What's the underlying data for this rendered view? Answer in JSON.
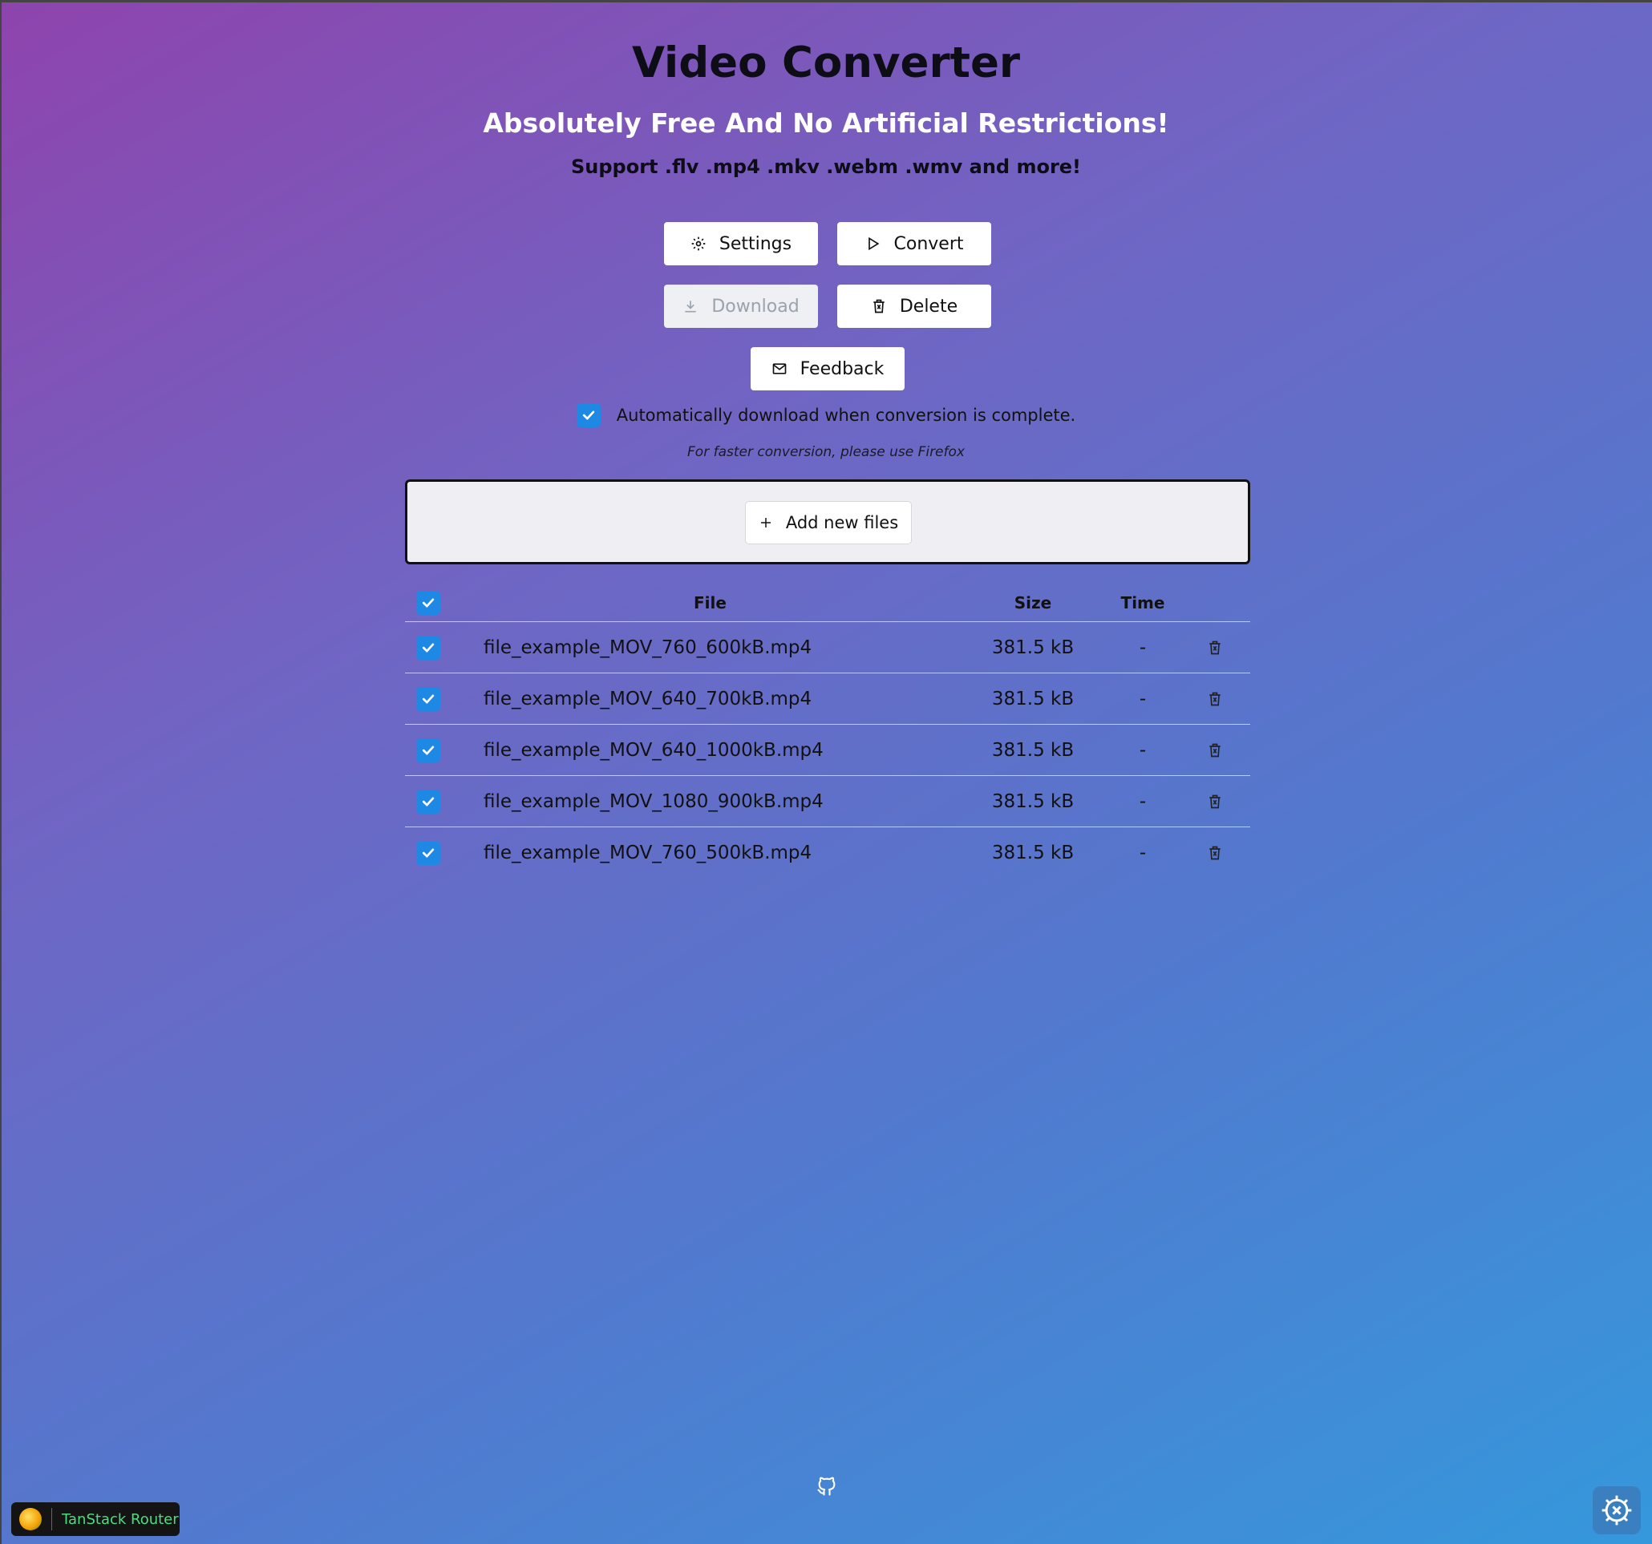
{
  "header": {
    "title": "Video Converter",
    "subtitle": "Absolutely Free And No Artificial Restrictions!",
    "support": "Support .flv .mp4 .mkv .webm .wmv and more!"
  },
  "toolbar": {
    "settings_label": "Settings",
    "convert_label": "Convert",
    "download_label": "Download",
    "delete_label": "Delete",
    "feedback_label": "Feedback"
  },
  "auto_download": {
    "label": "Automatically download when conversion is complete.",
    "checked": true
  },
  "hint": "For faster conversion, please use Firefox",
  "dropzone": {
    "add_label": "Add new files"
  },
  "table": {
    "headers": {
      "file": "File",
      "size": "Size",
      "time": "Time"
    },
    "rows": [
      {
        "file": "file_example_MOV_760_600kB.mp4",
        "size": "381.5 kB",
        "time": "-"
      },
      {
        "file": "file_example_MOV_640_700kB.mp4",
        "size": "381.5 kB",
        "time": "-"
      },
      {
        "file": "file_example_MOV_640_1000kB.mp4",
        "size": "381.5 kB",
        "time": "-"
      },
      {
        "file": "file_example_MOV_1080_900kB.mp4",
        "size": "381.5 kB",
        "time": "-"
      },
      {
        "file": "file_example_MOV_760_500kB.mp4",
        "size": "381.5 kB",
        "time": "-"
      }
    ]
  },
  "footer": {
    "devtools_label": "TanStack Router"
  },
  "icons": {
    "settings": "gear-icon",
    "convert": "play-icon",
    "download": "download-icon",
    "delete": "trash-icon",
    "feedback": "mail-icon",
    "add": "plus-icon",
    "github": "github-icon",
    "checkbox": "check-icon"
  },
  "colors": {
    "checkbox": "#1e88e5",
    "devtools_text": "#4ade80"
  }
}
